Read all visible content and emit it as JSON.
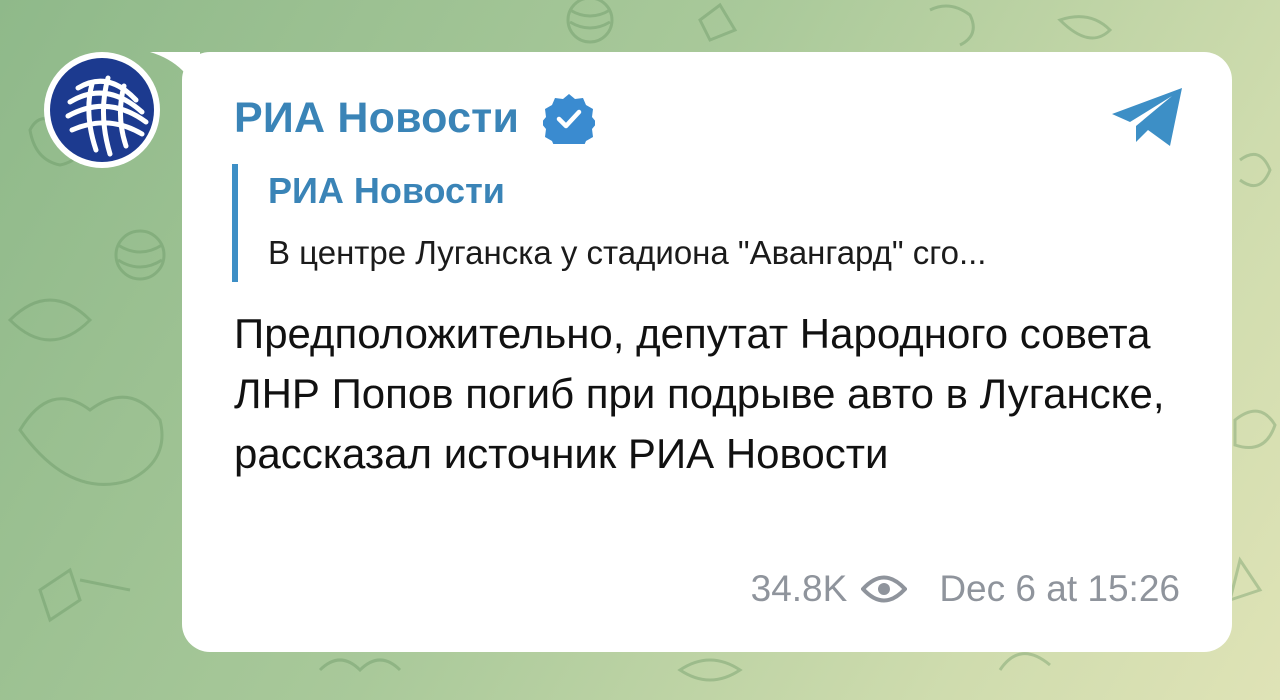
{
  "channel": {
    "name": "РИА Новости",
    "verified_icon": "verified-check-icon",
    "avatar_icon": "ria-logo-icon",
    "app_icon": "telegram-plane-icon"
  },
  "quote": {
    "title": "РИА Новости",
    "text": "В центре Луганска у стадиона \"Авангард\" сго..."
  },
  "message": {
    "text": "Предположительно, депутат Народного совета ЛНР Попов погиб при подрыве авто в Луганске, рассказал источник РИА Новости"
  },
  "footer": {
    "views": "34.8K",
    "views_icon": "eye-icon",
    "timestamp": "Dec 6 at 15:26"
  },
  "colors": {
    "accent": "#3a84b7",
    "background": "#a9c99a",
    "bubble": "#ffffff",
    "meta": "#8f949c"
  }
}
